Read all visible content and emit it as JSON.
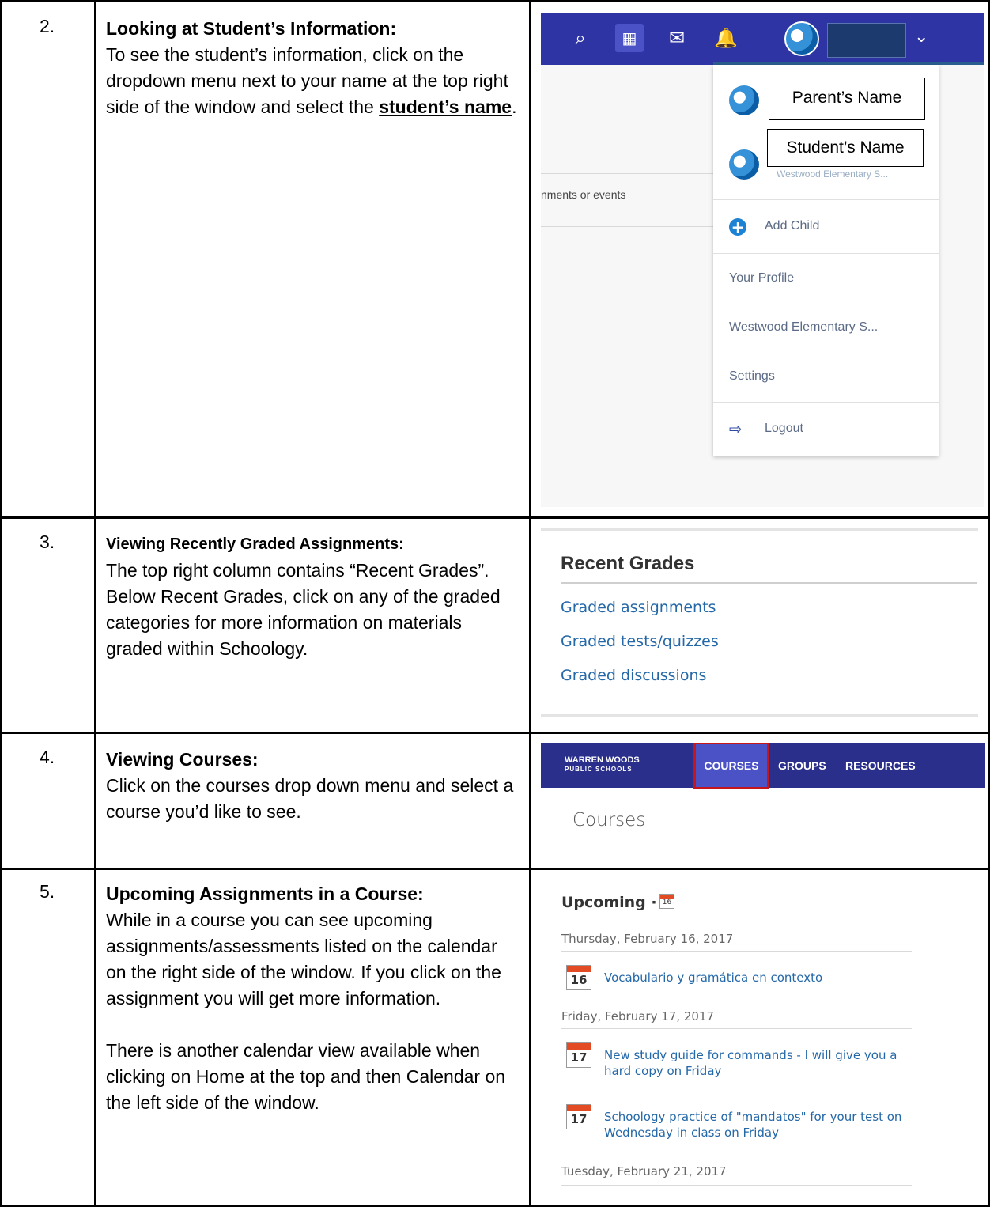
{
  "rows": [
    {
      "number": "2.",
      "heading": "Looking at Student’s Information:",
      "body_pre": "To see the student’s information, click on the dropdown menu next to your name at the top right side of the window and select the ",
      "body_emph": "student’s name",
      "body_post": "."
    },
    {
      "number": "3.",
      "heading": "Viewing Recently Graded Assignments:",
      "body": "The top right column contains “Recent Grades”. Below Recent Grades, click on any of the graded categories for more information on materials graded within Schoology."
    },
    {
      "number": "4.",
      "heading": "Viewing Courses:",
      "body": "Click on the courses drop down menu and select a course you’d like to see."
    },
    {
      "number": "5.",
      "heading": "Upcoming Assignments in a Course:",
      "body1": "While in a course you can see upcoming assignments/assessments listed on the calendar on the right side of the window. If you click on the assignment you will get more information.",
      "body2": "There is another calendar view available when clicking on Home at the top and then Calendar on the left side of the window."
    }
  ],
  "shot2": {
    "background_text": "nments or events",
    "callout_parent": "Parent’s Name",
    "callout_student": "Student’s Name",
    "student_school": "Westwood Elementary S...",
    "add_child": "Add Child",
    "your_profile": "Your Profile",
    "school": "Westwood Elementary S...",
    "settings": "Settings",
    "logout": "Logout",
    "icons": [
      "search-icon",
      "calendar-icon",
      "mail-icon",
      "bell-icon",
      "avatar",
      "chevron-down-icon"
    ]
  },
  "shot3": {
    "title": "Recent Grades",
    "links": [
      "Graded assignments",
      "Graded tests/quizzes",
      "Graded discussions"
    ]
  },
  "shot4": {
    "logo_line1": "WARREN WOODS",
    "logo_line2": "PUBLIC SCHOOLS",
    "nav_courses": "COURSES",
    "nav_groups": "GROUPS",
    "nav_resources": "RESOURCES",
    "heading": "Courses"
  },
  "shot5": {
    "title": "Upcoming ·",
    "mini_cal_day": "16",
    "dates": [
      "Thursday, February 16, 2017",
      "Friday, February 17, 2017",
      "Tuesday, February 21, 2017"
    ],
    "items": [
      {
        "day": "16",
        "text": "Vocabulario y gramática en contexto"
      },
      {
        "day": "17",
        "text": "New study guide for commands - I will give you a hard copy on Friday"
      },
      {
        "day": "17",
        "text": "Schoology practice of \"mandatos\" for your test on Wednesday in class on Friday"
      }
    ]
  },
  "colors": {
    "topbar": "#2e34a3",
    "navbar": "#2a2f8c",
    "link": "#2468a8",
    "highlight_border": "#c4161c"
  }
}
